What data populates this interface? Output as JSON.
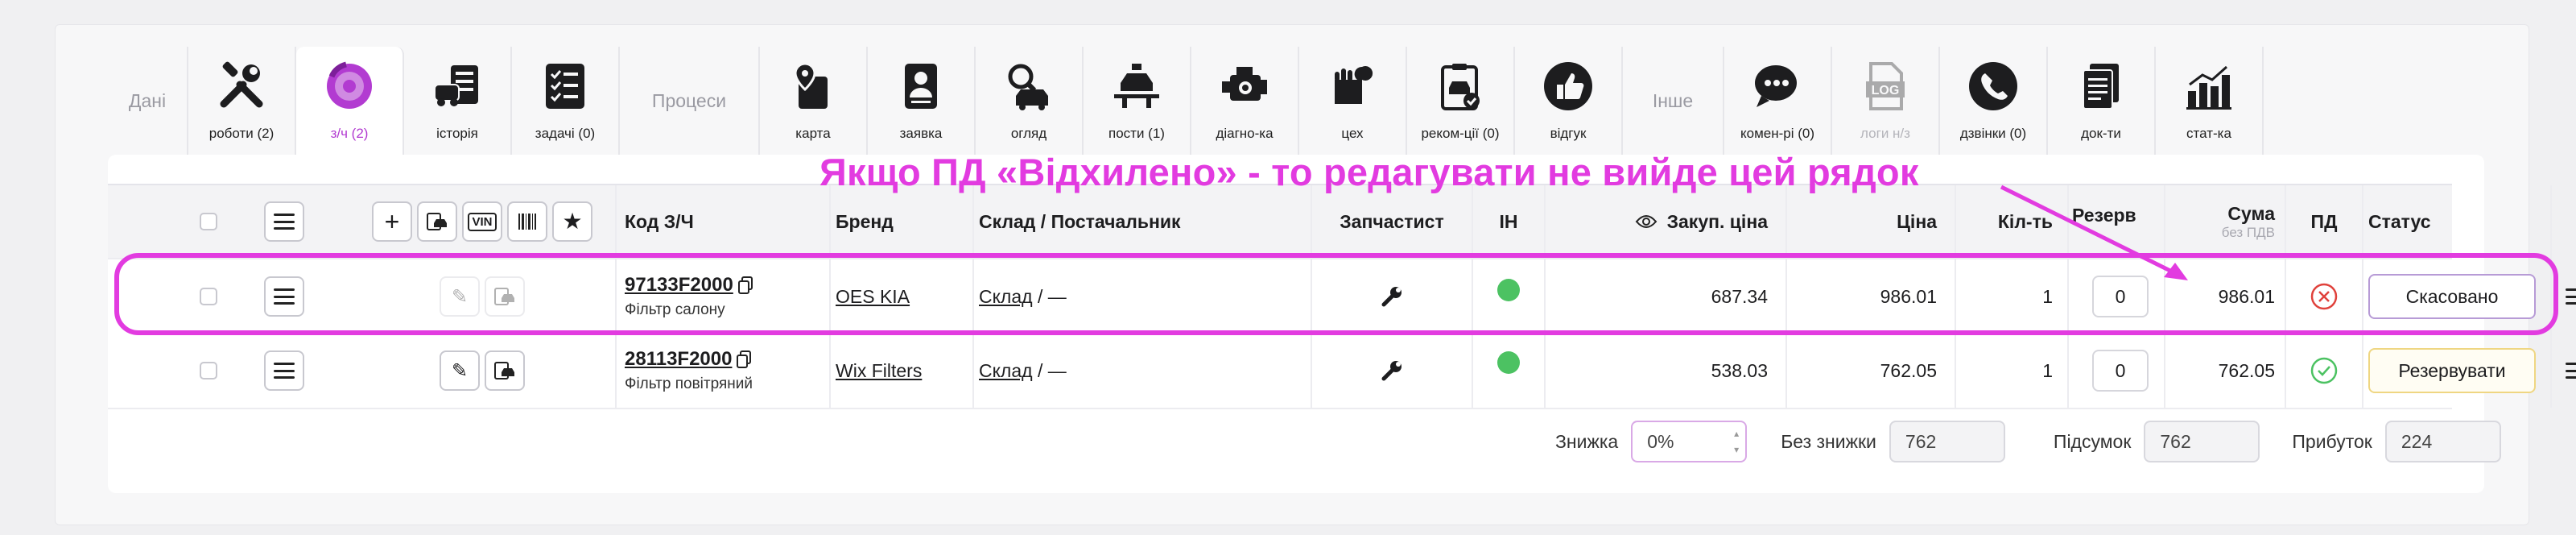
{
  "tabs": {
    "groups": {
      "data": "Дані",
      "processes": "Процеси",
      "other": "Інше"
    },
    "items": [
      {
        "key": "works",
        "label": "роботи (2)",
        "icon": "tools-icon"
      },
      {
        "key": "parts",
        "label": "з/ч (2)",
        "icon": "brake-disc-icon",
        "active": true
      },
      {
        "key": "history",
        "label": "історія",
        "icon": "car-history-icon"
      },
      {
        "key": "tasks",
        "label": "задачі (0)",
        "icon": "checklist-icon"
      },
      {
        "key": "card",
        "label": "карта",
        "icon": "map-pin-icon"
      },
      {
        "key": "request",
        "label": "заявка",
        "icon": "person-doc-icon"
      },
      {
        "key": "inspection",
        "label": "огляд",
        "icon": "car-search-icon"
      },
      {
        "key": "posts",
        "label": "пости (1)",
        "icon": "car-lift-icon"
      },
      {
        "key": "diagnostics",
        "label": "діагно-ка",
        "icon": "engine-icon"
      },
      {
        "key": "workshop",
        "label": "цех",
        "icon": "glove-wrench-icon"
      },
      {
        "key": "recommendations",
        "label": "реком-ції (0)",
        "icon": "clipboard-car-icon"
      },
      {
        "key": "feedback",
        "label": "відгук",
        "icon": "thumbs-up-icon"
      },
      {
        "key": "comments",
        "label": "комен-рі (0)",
        "icon": "chat-bubbles-icon"
      },
      {
        "key": "logs",
        "label": "логи н/з",
        "icon": "log-icon",
        "disabled": true
      },
      {
        "key": "calls",
        "label": "дзвінки (0)",
        "icon": "phone-icon"
      },
      {
        "key": "docs",
        "label": "док-ти",
        "icon": "documents-icon"
      },
      {
        "key": "stats",
        "label": "стат-ка",
        "icon": "bar-chart-icon"
      }
    ]
  },
  "table": {
    "headers": {
      "code": "Код З/Ч",
      "brand": "Бренд",
      "warehouse": "Склад / Постачальник",
      "parts_manager": "Запчастист",
      "in": "ІН",
      "purchase_price": "Закуп. ціна",
      "price": "Ціна",
      "qty": "Кіл-ть",
      "reserve": "Резерв",
      "sum": "Сума",
      "sum_sub": "без ПДВ",
      "pd": "ПД",
      "status": "Статус"
    },
    "toolbar": {
      "vin_label": "VIN"
    },
    "rows": [
      {
        "code": "97133F2000",
        "name": "Фільтр салону",
        "brand": "OES KIA",
        "warehouse": "Склад",
        "supplier": " / —",
        "purchase_price": "687.34",
        "price": "986.01",
        "qty": "1",
        "reserve": "0",
        "sum": "986.01",
        "pd_state": "rejected",
        "status": "Скасовано"
      },
      {
        "code": "28113F2000",
        "name": "Фільтр повітряний",
        "brand": "Wix Filters",
        "warehouse": "Склад",
        "supplier": " / —",
        "purchase_price": "538.03",
        "price": "762.05",
        "qty": "1",
        "reserve": "0",
        "sum": "762.05",
        "pd_state": "approved",
        "status": "Резервувати"
      }
    ]
  },
  "summary": {
    "discount_label": "Знижка",
    "discount_value": "0%",
    "no_discount_label": "Без знижки",
    "no_discount_value": "762",
    "total_label": "Підсумок",
    "total_value": "762",
    "profit_label": "Прибуток",
    "profit_value": "224"
  },
  "annotation": "Якщо ПД «Відхилено» - то редагувати не вийде цей рядок",
  "colors": {
    "accent": "#b23bd1",
    "annotation": "#e23be0",
    "ok": "#4cc262",
    "reject": "#e0423c"
  }
}
